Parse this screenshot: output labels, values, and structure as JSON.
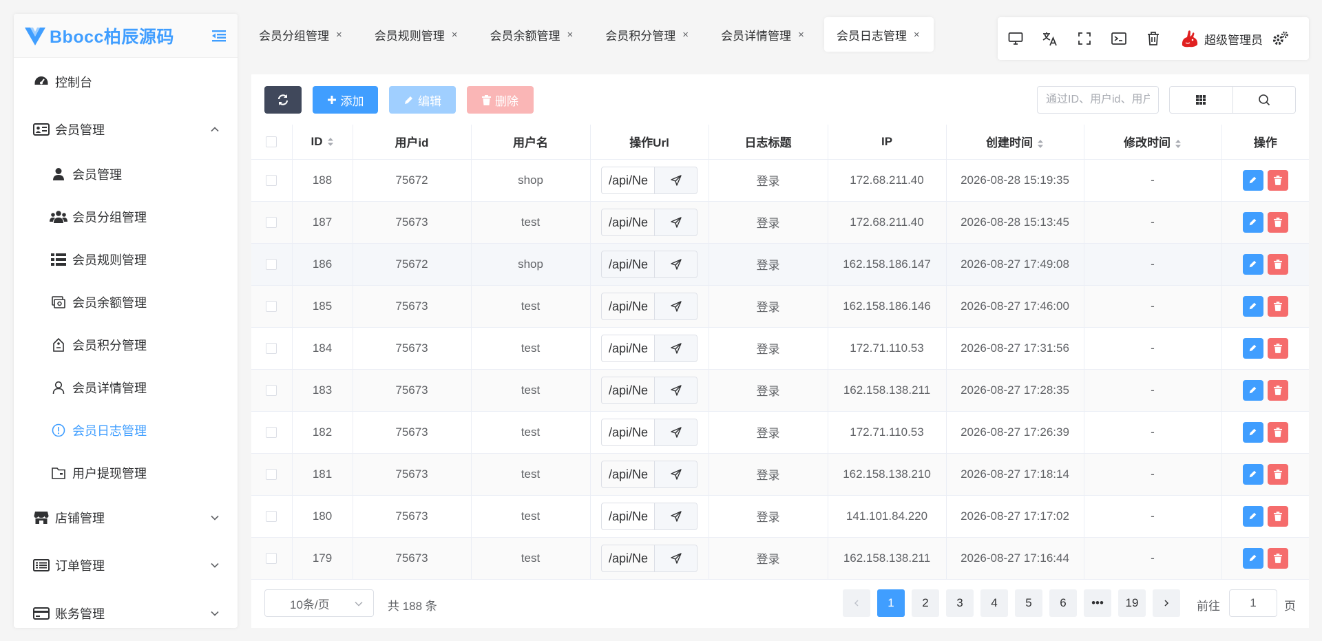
{
  "brand": {
    "title": "Bbocc柏辰源码",
    "accent": "#409eff"
  },
  "sidebar": {
    "items": [
      {
        "label": "控制台",
        "icon": "dashboard-icon"
      },
      {
        "label": "会员管理",
        "icon": "id-card-icon",
        "expanded": true
      },
      {
        "label": "店铺管理",
        "icon": "store-icon",
        "expanded": false
      },
      {
        "label": "订单管理",
        "icon": "list-icon",
        "expanded": false
      },
      {
        "label": "账务管理",
        "icon": "credit-card-icon",
        "expanded": false
      }
    ],
    "submenu": [
      {
        "label": "会员管理",
        "icon": "user-icon"
      },
      {
        "label": "会员分组管理",
        "icon": "users-icon"
      },
      {
        "label": "会员规则管理",
        "icon": "list-icon"
      },
      {
        "label": "会员余额管理",
        "icon": "money-icon"
      },
      {
        "label": "会员积分管理",
        "icon": "tag-icon"
      },
      {
        "label": "会员详情管理",
        "icon": "person-icon"
      },
      {
        "label": "会员日志管理",
        "icon": "info-circle-icon",
        "active": true
      },
      {
        "label": "用户提现管理",
        "icon": "folder-icon"
      }
    ]
  },
  "tabs": [
    {
      "label": "会员分组管理"
    },
    {
      "label": "会员规则管理"
    },
    {
      "label": "会员余额管理"
    },
    {
      "label": "会员积分管理"
    },
    {
      "label": "会员详情管理"
    },
    {
      "label": "会员日志管理",
      "active": true
    }
  ],
  "toolbar": {
    "admin_name": "超级管理员",
    "icons": [
      "monitor-icon",
      "translate-icon",
      "fullscreen-icon",
      "terminal-icon",
      "trash-icon",
      "settings-icon"
    ]
  },
  "actions": {
    "add_label": "添加",
    "edit_label": "编辑",
    "delete_label": "删除",
    "search_placeholder": "通过ID、用户id、用户名模糊搜索"
  },
  "table": {
    "columns": [
      "ID",
      "用户id",
      "用户名",
      "操作Url",
      "日志标题",
      "IP",
      "创建时间",
      "修改时间",
      "操作"
    ],
    "rows": [
      {
        "id": "188",
        "user_id": "75672",
        "username": "shop",
        "url": "/api/Ne",
        "title": "登录",
        "ip": "172.68.211.40",
        "created": "2026-08-28 15:19:35",
        "updated": "-"
      },
      {
        "id": "187",
        "user_id": "75673",
        "username": "test",
        "url": "/api/Ne",
        "title": "登录",
        "ip": "172.68.211.40",
        "created": "2026-08-28 15:13:45",
        "updated": "-"
      },
      {
        "id": "186",
        "user_id": "75672",
        "username": "shop",
        "url": "/api/Ne",
        "title": "登录",
        "ip": "162.158.186.147",
        "created": "2026-08-27 17:49:08",
        "updated": "-"
      },
      {
        "id": "185",
        "user_id": "75673",
        "username": "test",
        "url": "/api/Ne",
        "title": "登录",
        "ip": "162.158.186.146",
        "created": "2026-08-27 17:46:00",
        "updated": "-"
      },
      {
        "id": "184",
        "user_id": "75673",
        "username": "test",
        "url": "/api/Ne",
        "title": "登录",
        "ip": "172.71.110.53",
        "created": "2026-08-27 17:31:56",
        "updated": "-"
      },
      {
        "id": "183",
        "user_id": "75673",
        "username": "test",
        "url": "/api/Ne",
        "title": "登录",
        "ip": "162.158.138.211",
        "created": "2026-08-27 17:28:35",
        "updated": "-"
      },
      {
        "id": "182",
        "user_id": "75673",
        "username": "test",
        "url": "/api/Ne",
        "title": "登录",
        "ip": "172.71.110.53",
        "created": "2026-08-27 17:26:39",
        "updated": "-"
      },
      {
        "id": "181",
        "user_id": "75673",
        "username": "test",
        "url": "/api/Ne",
        "title": "登录",
        "ip": "162.158.138.210",
        "created": "2026-08-27 17:18:14",
        "updated": "-"
      },
      {
        "id": "180",
        "user_id": "75673",
        "username": "test",
        "url": "/api/Ne",
        "title": "登录",
        "ip": "141.101.84.220",
        "created": "2026-08-27 17:17:02",
        "updated": "-"
      },
      {
        "id": "179",
        "user_id": "75673",
        "username": "test",
        "url": "/api/Ne",
        "title": "登录",
        "ip": "162.158.138.211",
        "created": "2026-08-27 17:16:44",
        "updated": "-"
      }
    ]
  },
  "pagination": {
    "page_size_label": "10条/页",
    "total_label": "共 188 条",
    "pages": [
      "1",
      "2",
      "3",
      "4",
      "5",
      "6",
      "•••",
      "19"
    ],
    "current": "1",
    "jump_label": "前往",
    "jump_value": "1",
    "jump_suffix": "页"
  }
}
